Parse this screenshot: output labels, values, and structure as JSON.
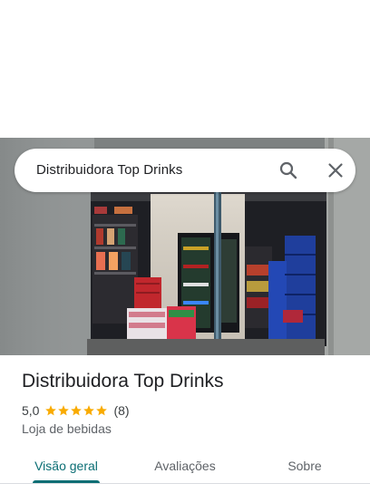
{
  "search": {
    "query": "Distribuidora Top Drinks",
    "search_icon": "search-icon",
    "close_icon": "close-icon"
  },
  "hero": {
    "image": "storefront-photo"
  },
  "place": {
    "name": "Distribuidora Top Drinks",
    "rating": "5,0",
    "stars": 5,
    "reviews": "(8)",
    "category": "Loja de bebidas"
  },
  "tabs": [
    {
      "label": "Visão geral",
      "active": true
    },
    {
      "label": "Avaliações",
      "active": false
    },
    {
      "label": "Sobre",
      "active": false
    }
  ],
  "colors": {
    "accent": "#0b6e74",
    "star": "#f9ab00",
    "text_primary": "#202124",
    "text_secondary": "#5f6368"
  }
}
